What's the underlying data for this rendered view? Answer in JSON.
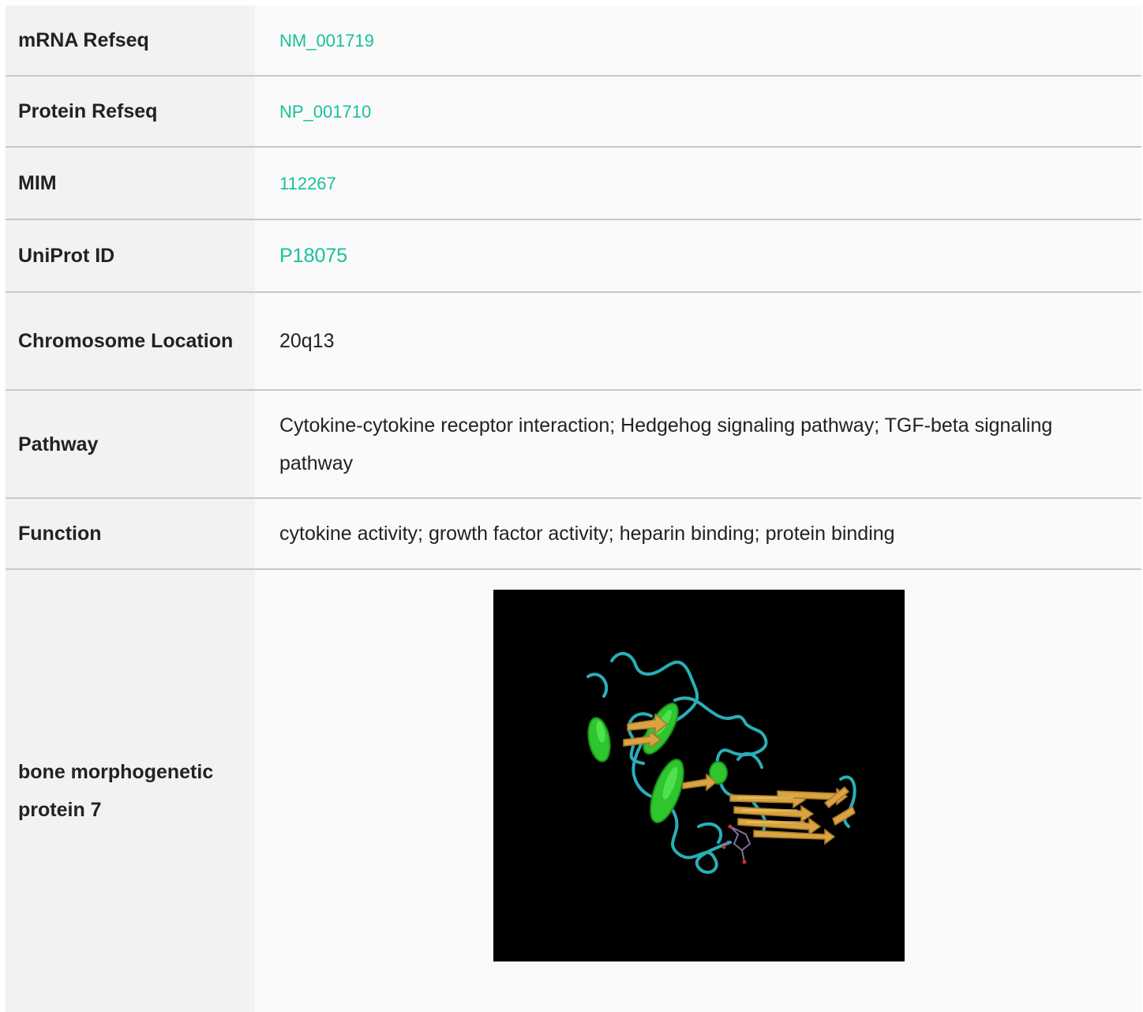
{
  "rows": {
    "mrna": {
      "label": "mRNA Refseq",
      "value": "NM_001719"
    },
    "protein": {
      "label": "Protein Refseq",
      "value": "NP_001710"
    },
    "mim": {
      "label": "MIM",
      "value": "112267"
    },
    "uniprot": {
      "label": "UniProt ID",
      "value": "P18075"
    },
    "chromosome": {
      "label": "Chromosome Location",
      "value": "20q13"
    },
    "pathway": {
      "label": "Pathway",
      "value": "Cytokine-cytokine receptor interaction; Hedgehog signaling pathway; TGF-beta signaling pathway"
    },
    "function": {
      "label": "Function",
      "value": "cytokine activity; growth factor activity; heparin binding; protein binding"
    },
    "gene": {
      "label": "bone morphogenetic protein 7"
    }
  },
  "colors": {
    "link": "#17c19a",
    "label_bg": "#f2f2f2",
    "value_bg": "#fafafa",
    "divider": "#c8c8c8"
  }
}
